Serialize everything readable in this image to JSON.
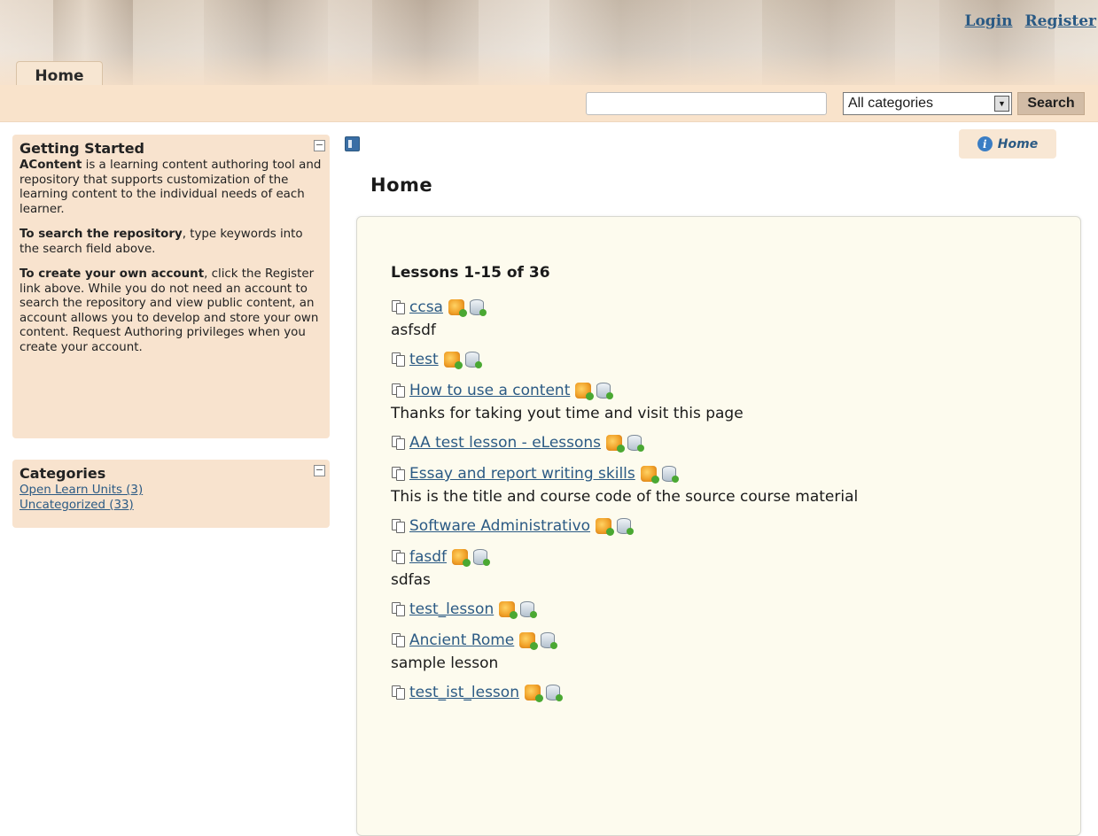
{
  "header": {
    "links": [
      {
        "label": "Login"
      },
      {
        "label": "Register"
      }
    ],
    "tab": "Home"
  },
  "search": {
    "placeholder": "",
    "value": "",
    "category_selected": "All categories",
    "button_label": "Search"
  },
  "sidebar": {
    "getting_started": {
      "title": "Getting Started",
      "p1_bold": "AContent",
      "p1_rest": " is a learning content authoring tool and repository that supports customization of the learning content to the individual needs of each learner.",
      "p2_bold": "To search the repository",
      "p2_rest": ", type keywords into the search field above.",
      "p3_bold": "To create your own account",
      "p3_rest": ", click the Register link above. While you do not need an account to search the repository and view public content, an account allows you to develop and store your own content. Request Authoring privileges when you create your account."
    },
    "categories": {
      "title": "Categories",
      "items": [
        {
          "label": "Open Learn Units (3)"
        },
        {
          "label": "Uncategorized (33)"
        }
      ]
    }
  },
  "main": {
    "breadcrumb": "Home",
    "page_title": "Home",
    "lessons_count": "Lessons 1-15 of 36",
    "lessons": [
      {
        "title": "ccsa",
        "desc": "asfsdf"
      },
      {
        "title": "test",
        "desc": ""
      },
      {
        "title": "How to use a content",
        "desc": "Thanks for taking yout time and visit this page"
      },
      {
        "title": "AA test lesson - eLessons",
        "desc": ""
      },
      {
        "title": "Essay and report writing skills",
        "desc": "This is the title and course code of the source course material"
      },
      {
        "title": "Software Administrativo",
        "desc": ""
      },
      {
        "title": "fasdf",
        "desc": "sdfas"
      },
      {
        "title": "test_lesson",
        "desc": ""
      },
      {
        "title": "Ancient Rome",
        "desc": "sample lesson"
      },
      {
        "title": "test_ist_lesson",
        "desc": ""
      }
    ]
  },
  "colors": {
    "link": "#2b5a84",
    "sidebar_bg": "#f8e3ce",
    "search_strip_bg": "#f9e3cb",
    "panel_bg": "#fdfbee"
  }
}
